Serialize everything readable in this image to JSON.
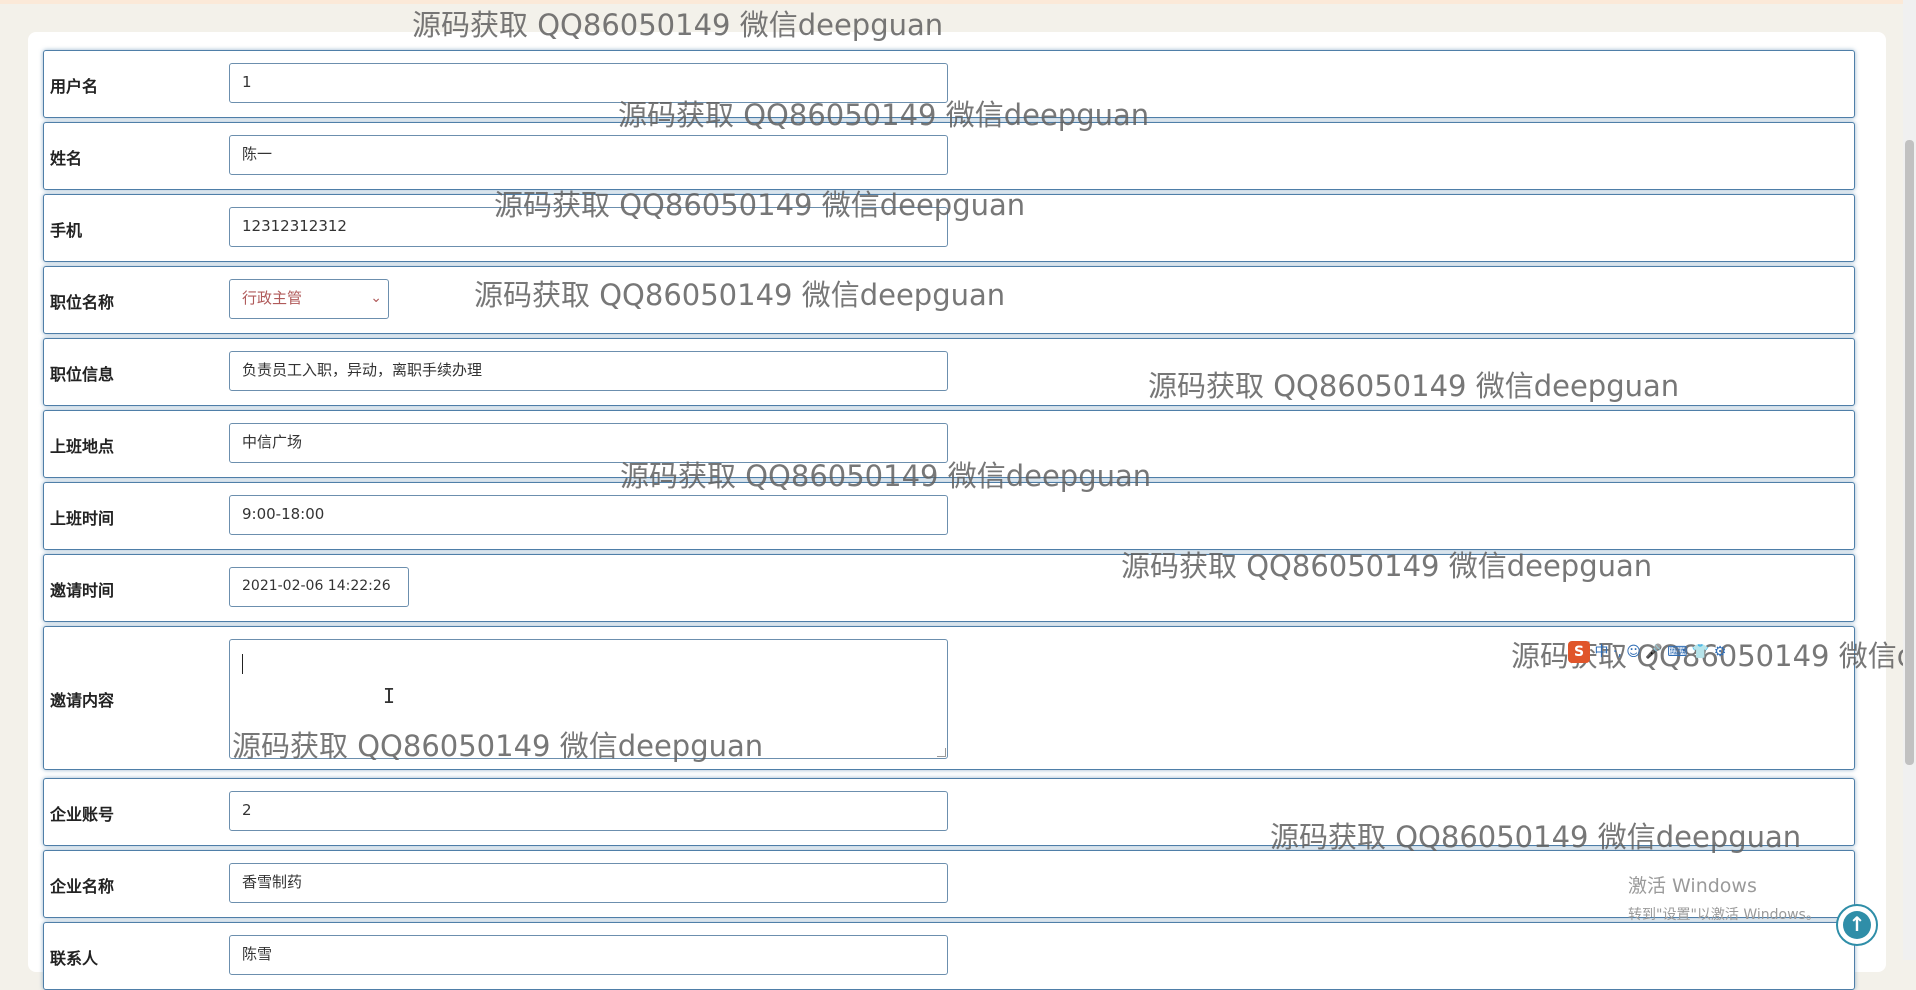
{
  "form": {
    "fields": [
      {
        "label": "用户名",
        "value": "1"
      },
      {
        "label": "姓名",
        "value": "陈一"
      },
      {
        "label": "手机",
        "value": "12312312312"
      },
      {
        "label": "职位名称",
        "value": "行政主管"
      },
      {
        "label": "职位信息",
        "value": "负责员工入职，异动，离职手续办理"
      },
      {
        "label": "上班地点",
        "value": "中信广场"
      },
      {
        "label": "上班时间",
        "value": "9:00-18:00"
      },
      {
        "label": "邀请时间",
        "value": "2021-02-06 14:22:26"
      },
      {
        "label": "邀请内容",
        "value": ""
      },
      {
        "label": "企业账号",
        "value": "2"
      },
      {
        "label": "企业名称",
        "value": "香雪制药"
      },
      {
        "label": "联系人",
        "value": "陈雪"
      }
    ]
  },
  "watermark": {
    "text": "源码获取 QQ86050149 微信deepguan"
  },
  "os_notice": {
    "title": "激活 Windows",
    "subtitle": "转到\"设置\"以激活 Windows。"
  },
  "icons": {
    "back_to_top": "arrow-up-circle-icon",
    "select_arrow": "chevron-down-icon",
    "ime_logo": "sogou-s-icon"
  },
  "ime_toolbar": {
    "logo": "S",
    "label": "中 ·, ☺ 🎤 ⌨ 👕 ⚙"
  },
  "colors": {
    "row_border": "#4f7fa8",
    "select_text": "#b05a5a",
    "back_to_top": "#2f8ea8"
  }
}
